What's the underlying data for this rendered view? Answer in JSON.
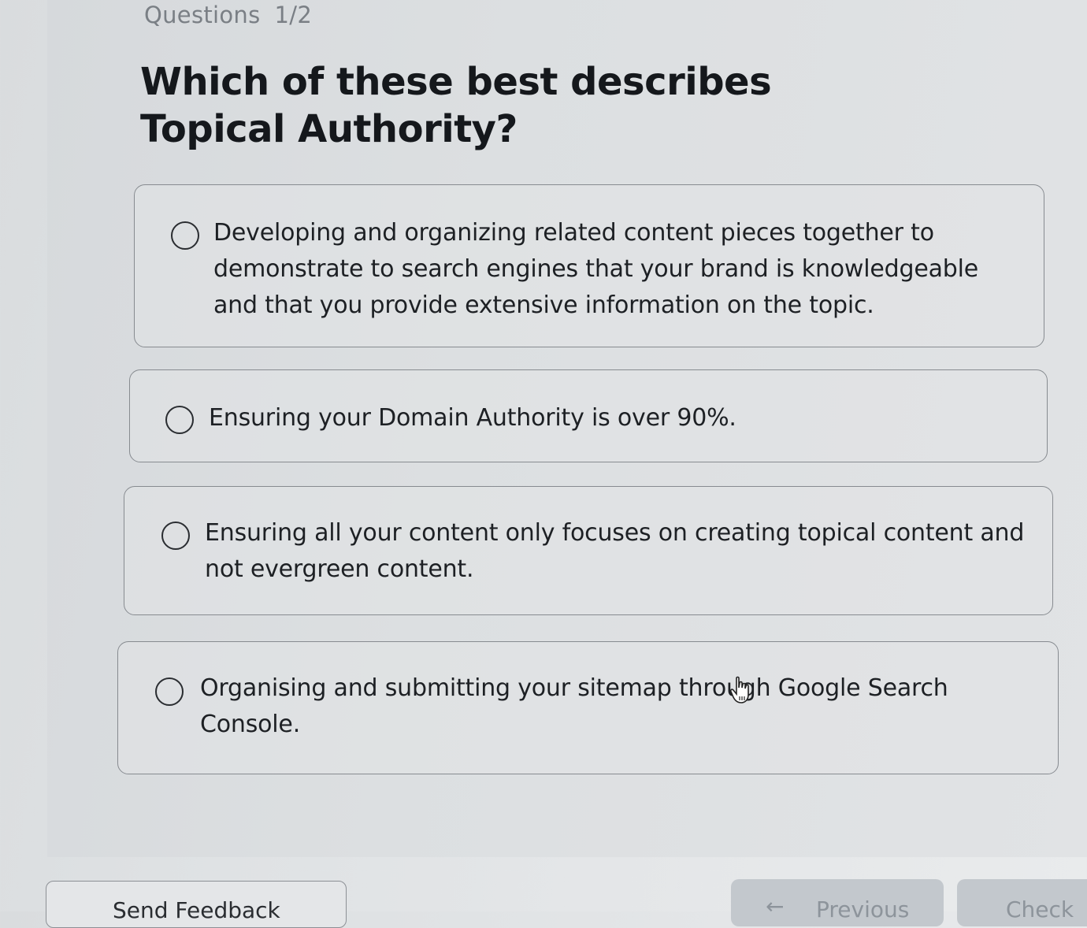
{
  "header": {
    "label": "Questions",
    "progress": "1/2"
  },
  "question": {
    "text": "Which of these best describes Topical Authority?"
  },
  "options": [
    {
      "text": "Developing and organizing related content pieces together to demonstrate to search engines that your brand is knowledgeable and that you provide extensive information on the topic.",
      "selected": false
    },
    {
      "text": "Ensuring your Domain Authority is over 90%.",
      "selected": false
    },
    {
      "text": "Ensuring all your content only focuses on creating topical content and not evergreen content.",
      "selected": false
    },
    {
      "text": "Organising and submitting your sitemap through Google Search Console.",
      "selected": false
    }
  ],
  "footer": {
    "feedback_label": "Send Feedback",
    "previous_label": "Previous",
    "check_label": "Check"
  },
  "icons": {
    "radio": "radio-unchecked-icon",
    "previous_arrow": "arrow-left-icon",
    "cursor": "hand-pointer-icon"
  },
  "colors": {
    "background": "#dfe2e4",
    "option_border": "#878b90",
    "text": "#1b1e23",
    "muted_text": "#7a7f85",
    "disabled_button": "#c3c8cd"
  }
}
